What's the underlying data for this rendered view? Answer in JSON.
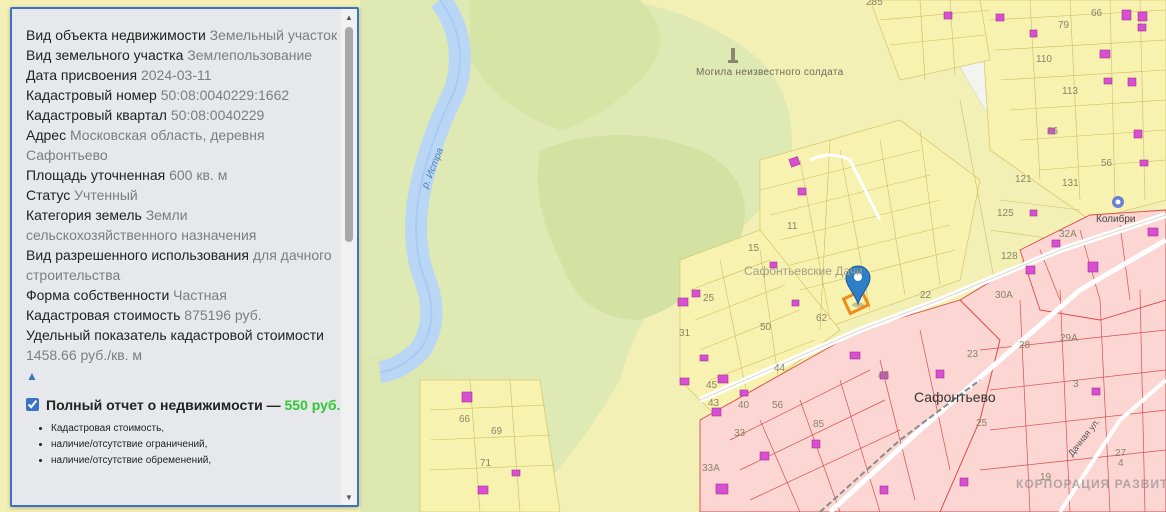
{
  "info": {
    "rows": [
      {
        "label": "Вид объекта недвижимости",
        "value": "Земельный участок"
      },
      {
        "label": "Вид земельного участка",
        "value": "Землепользование"
      },
      {
        "label": "Дата присвоения",
        "value": "2024-03-11"
      },
      {
        "label": "Кадастровый номер",
        "value": "50:08:0040229:1662"
      },
      {
        "label": "Кадастровый квартал",
        "value": "50:08:0040229"
      },
      {
        "label": "Адрес",
        "value": "Московская область, деревня Сафонтьево"
      },
      {
        "label": "Площадь уточненная",
        "value": "600 кв. м"
      },
      {
        "label": "Статус",
        "value": "Учтенный"
      },
      {
        "label": "Категория земель",
        "value": "Земли сельскохозяйственного назначения"
      },
      {
        "label": "Вид разрешенного использования",
        "value": "для дачного строительства"
      },
      {
        "label": "Форма собственности",
        "value": "Частная"
      },
      {
        "label": "Кадастровая стоимость",
        "value": "875196 руб."
      },
      {
        "label": "Удельный показатель кадастровой стоимости",
        "value": "1458.66 руб./кв. м"
      }
    ],
    "collapse_glyph": "▲",
    "report": {
      "checked": true,
      "title": "Полный отчет о недвижимости —",
      "price": "550 руб.",
      "items": [
        "Кадастровая стоимость,",
        "наличие/отсутствие ограничений,",
        "наличие/отсутствие обременений,"
      ]
    }
  },
  "map": {
    "river_label": "р. Истра",
    "monument_label": "Могила неизвестного солдата",
    "dacha_label": "Сафонтьевские Дачи",
    "village_label": "Сафонтьево",
    "poi_label": "Колибри",
    "road_label": "Дачная ул.",
    "watermark": "КОРПОРАЦИЯ РАЗВИТИЯ",
    "plot_numbers": [
      "285",
      "79",
      "66",
      "110",
      "113",
      "16",
      "56",
      "121",
      "131",
      "125",
      "128",
      "32А",
      "30А",
      "28",
      "29А",
      "23",
      "22",
      "3",
      "11",
      "15",
      "25",
      "31",
      "50",
      "62",
      "44",
      "45",
      "43",
      "40",
      "56",
      "33",
      "33А",
      "85",
      "48",
      "66",
      "69",
      "71",
      "4",
      "27",
      "25",
      "19"
    ]
  },
  "colors": {
    "panel_border": "#3b73c4",
    "price_green": "#32c832",
    "forest": "#dde9b0",
    "plots": "#f8f1a8",
    "village_plots": "#fbd6d2",
    "building": "#d84fcf",
    "river": "#a9c9f2",
    "marker": "#2f7fc8"
  }
}
